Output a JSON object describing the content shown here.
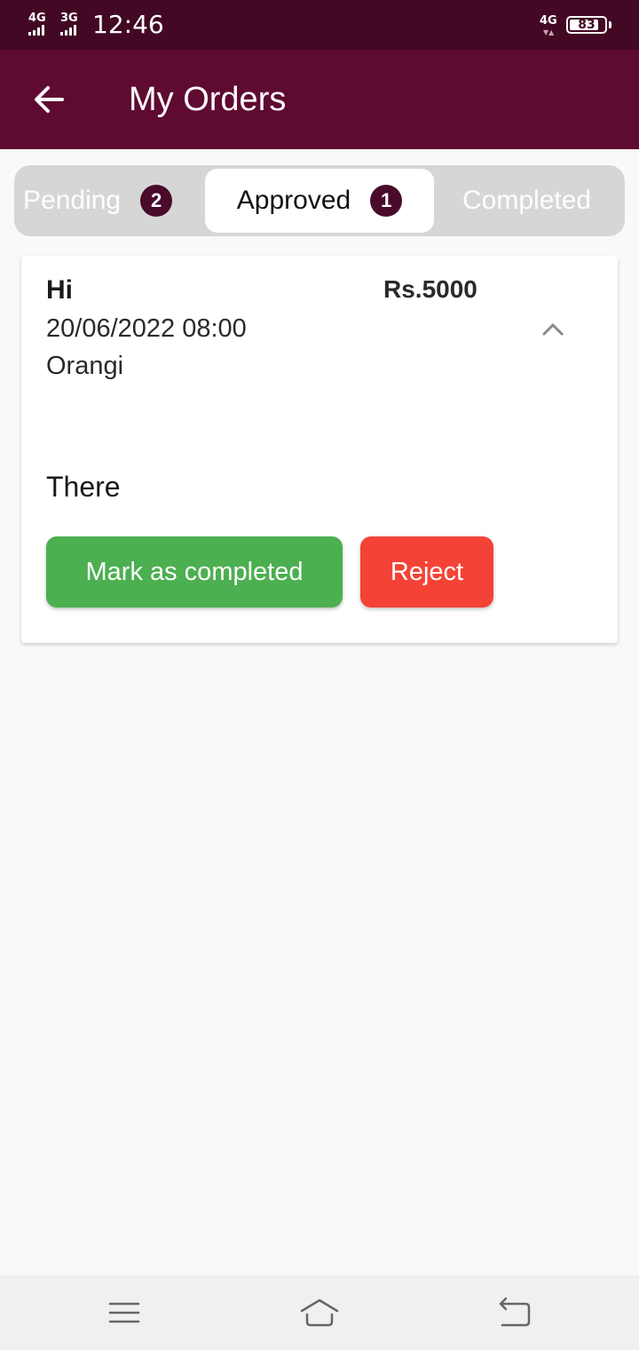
{
  "status_bar": {
    "network_1": "4G",
    "network_2": "3G",
    "time": "12:46",
    "network_right": "4G",
    "battery_level": "83",
    "battery_percent": 83
  },
  "app_bar": {
    "title": "My Orders",
    "back_icon": "arrow-left-icon"
  },
  "tabs": [
    {
      "label": "Pending",
      "count": "2",
      "active": false
    },
    {
      "label": "Approved",
      "count": "1",
      "active": true
    },
    {
      "label": "Completed",
      "count": "",
      "active": false
    }
  ],
  "order": {
    "name": "Hi",
    "price": "Rs.5000",
    "datetime": "20/06/2022 08:00",
    "location": "Orangi",
    "note": "There",
    "expand_icon": "chevron-up-icon",
    "complete_label": "Mark as completed",
    "reject_label": "Reject"
  },
  "colors": {
    "status_bar": "#430823",
    "app_bar": "#5f0a31",
    "badge": "#4a0a2a",
    "complete_button": "#4caf50",
    "reject_button": "#f44336"
  },
  "nav_bar": {
    "icons": [
      "menu-icon",
      "home-icon",
      "back-icon"
    ]
  }
}
